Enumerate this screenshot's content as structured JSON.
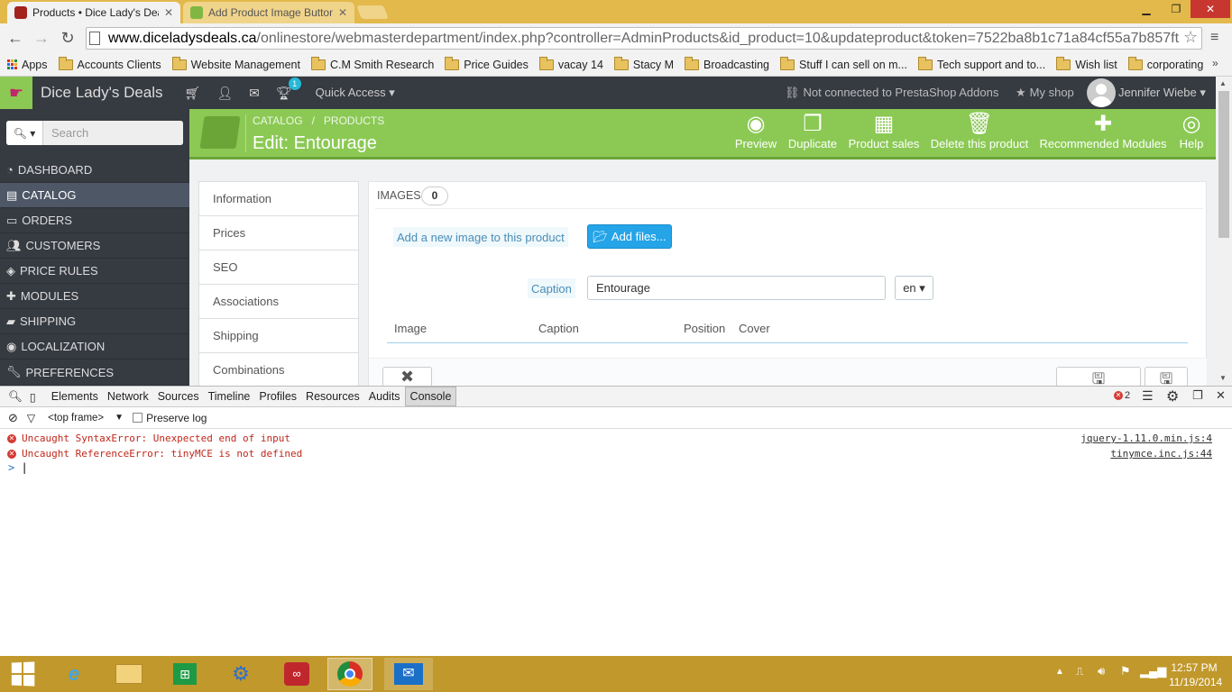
{
  "browser": {
    "tabs": [
      {
        "title": "Products • Dice Lady's Dea",
        "active": true
      },
      {
        "title": "Add Product Image Button",
        "active": false
      }
    ],
    "url_host": "www.diceladysdeals.ca",
    "url_path": "/onlinestore/webmasterdepartment/index.php?controller=AdminProducts&id_product=10&updateproduct&token=7522ba8b1c71a84cf55a7b857ft",
    "bookmarks": [
      "Apps",
      "Accounts Clients",
      "Website Management",
      "C.M Smith Research",
      "Price Guides",
      "vacay 14",
      "Stacy M",
      "Broadcasting",
      "Stuff I can sell on m...",
      "Tech support and to...",
      "Wish list",
      "corporating"
    ]
  },
  "header": {
    "shop_name": "Dice Lady's Deals",
    "notification_count": "1",
    "quick_access": "Quick Access",
    "addons_status": "Not connected to PrestaShop Addons",
    "my_shop": "My shop",
    "user_name": "Jennifer Wiebe"
  },
  "sidebar": {
    "search_placeholder": "Search",
    "items": [
      {
        "label": "DASHBOARD",
        "icon": "dashboard-icon"
      },
      {
        "label": "CATALOG",
        "icon": "book-icon"
      },
      {
        "label": "ORDERS",
        "icon": "credit-card-icon"
      },
      {
        "label": "CUSTOMERS",
        "icon": "users-icon"
      },
      {
        "label": "PRICE RULES",
        "icon": "tag-icon"
      },
      {
        "label": "MODULES",
        "icon": "puzzle-icon"
      },
      {
        "label": "SHIPPING",
        "icon": "truck-icon"
      },
      {
        "label": "LOCALIZATION",
        "icon": "globe-icon"
      },
      {
        "label": "PREFERENCES",
        "icon": "wrench-icon"
      }
    ]
  },
  "toolbar": {
    "breadcrumb_catalog": "CATALOG",
    "breadcrumb_sep": "/",
    "breadcrumb_products": "PRODUCTS",
    "title": "Edit: Entourage",
    "buttons": [
      "Preview",
      "Duplicate",
      "Product sales",
      "Delete this product",
      "Recommended Modules",
      "Help"
    ]
  },
  "product_tabs": [
    "Information",
    "Prices",
    "SEO",
    "Associations",
    "Shipping",
    "Combinations"
  ],
  "images_panel": {
    "heading": "IMAGES",
    "count": "0",
    "add_label": "Add a new image to this product",
    "add_button": "Add files...",
    "caption_label": "Caption",
    "caption_value": "Entourage",
    "language": "en",
    "columns": [
      "Image",
      "Caption",
      "Position",
      "Cover"
    ]
  },
  "devtools": {
    "tabs": [
      "Elements",
      "Network",
      "Sources",
      "Timeline",
      "Profiles",
      "Resources",
      "Audits",
      "Console"
    ],
    "error_count": "2",
    "frame": "<top frame>",
    "preserve_log": "Preserve log",
    "errors": [
      {
        "message": "Uncaught SyntaxError: Unexpected end of input",
        "source": "jquery-1.11.0.min.js:4"
      },
      {
        "message": "Uncaught ReferenceError: tinyMCE is not defined",
        "source": "tinymce.inc.js:44"
      }
    ],
    "prompt": ">"
  },
  "taskbar": {
    "time": "12:57 PM",
    "date": "11/19/2014"
  },
  "colors": {
    "accent_green": "#8bc954",
    "sidebar_dark": "#363a41",
    "button_blue": "#25a4e8",
    "error_red": "#c0271b"
  }
}
